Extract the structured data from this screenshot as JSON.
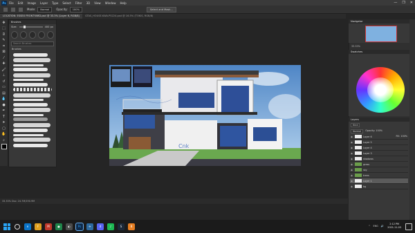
{
  "menubar": {
    "logo": "Ps",
    "items": [
      "File",
      "Edit",
      "Image",
      "Layer",
      "Type",
      "Select",
      "Filter",
      "3D",
      "View",
      "Window",
      "Help"
    ],
    "controls": [
      "—",
      "❐",
      "✕"
    ]
  },
  "options": {
    "mode_label": "Mode:",
    "mode_value": "Normal",
    "opacity_label": "Opacity:",
    "opacity_value": "100%",
    "share_label": "Select and Mask..."
  },
  "doc_tabs": [
    {
      "label": "LOCATION: ESSEX FRONTYARD.psd @ 33.3% (Layer 6, RGB/8)",
      "active": true
    },
    {
      "label": "GTAS_HOUSE.KWA.P5224.psd @ 16.5% (TOKIS, RGB/8)",
      "active": false
    }
  ],
  "brushes": {
    "title": "Brushes",
    "size_label": "Size:",
    "size_value": "400 px",
    "search_placeholder": "Search Brushes",
    "group_label": "Brushes"
  },
  "panels": {
    "navigator_title": "Navigator",
    "navigator_zoom": "33.33%",
    "swatches_title": "Swatches",
    "layers_title": "Layers",
    "layers_kind": "Kind",
    "layers_mode": "Normal",
    "layers_opacity": "Opacity: 100%",
    "layers_fill": "Fill: 100%"
  },
  "layers": [
    {
      "name": "Layer 6",
      "type": "white"
    },
    {
      "name": "Layer 5",
      "type": "white"
    },
    {
      "name": "Layer 4",
      "type": "white"
    },
    {
      "name": "Layer 3",
      "type": "white"
    },
    {
      "name": "shadows",
      "type": "white"
    },
    {
      "name": "grass",
      "type": "green"
    },
    {
      "name": "sky",
      "type": "green"
    },
    {
      "name": "trees",
      "type": "green"
    },
    {
      "name": "Layer 1",
      "type": "white",
      "selected": true
    },
    {
      "name": "bg",
      "type": "white"
    }
  ],
  "status": {
    "text": "33.33%    Doc: 24.7M/190.9M"
  },
  "taskbar": {
    "time": "2:12 PM",
    "date": "2021-11-03",
    "tray": [
      "^",
      "ENG",
      "🔊"
    ],
    "apps": [
      {
        "label": "e",
        "color": "#0b74c8"
      },
      {
        "label": "F",
        "color": "#e0a020"
      },
      {
        "label": "M",
        "color": "#c0392b"
      },
      {
        "label": "●",
        "color": "#1e8449"
      },
      {
        "label": "◐",
        "color": "#4a4a4a"
      },
      {
        "label": "Ps",
        "color": "#0e2a4a",
        "active": true
      },
      {
        "label": "✈",
        "color": "#2c6aa0"
      },
      {
        "label": "d",
        "color": "#5865f2"
      },
      {
        "label": "♪",
        "color": "#1db954"
      },
      {
        "label": "S",
        "color": "#1b2838"
      },
      {
        "label": "B",
        "color": "#e67e22"
      }
    ]
  },
  "canvas_note": "Cnk"
}
